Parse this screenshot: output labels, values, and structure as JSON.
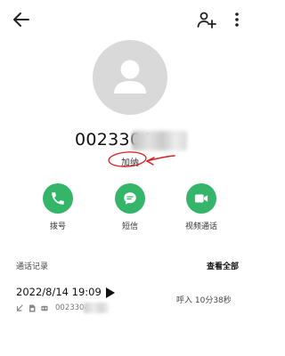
{
  "contact": {
    "number_visible": "0023304",
    "location": "加纳"
  },
  "actions": [
    {
      "label": "拨号",
      "icon": "phone-icon"
    },
    {
      "label": "短信",
      "icon": "message-icon"
    },
    {
      "label": "视频通话",
      "icon": "video-icon"
    }
  ],
  "call_log": {
    "title": "通话记录",
    "view_all": "查看全部",
    "entries": [
      {
        "datetime": "2022/8/14 19:09",
        "duration": "呼入 10分38秒",
        "number_visible": "0023304"
      }
    ]
  },
  "colors": {
    "accent_green": "#34b56a",
    "annotation_red": "#d42020",
    "avatar_gray": "#d9d9d9"
  },
  "icons": {
    "back": "arrow-left-icon",
    "add_contact": "person-add-icon",
    "more": "more-vertical-icon",
    "play": "play-icon",
    "incoming_call": "incoming-call-arrow-icon",
    "sim": "sim-card-icon",
    "recording": "recording-icon"
  }
}
